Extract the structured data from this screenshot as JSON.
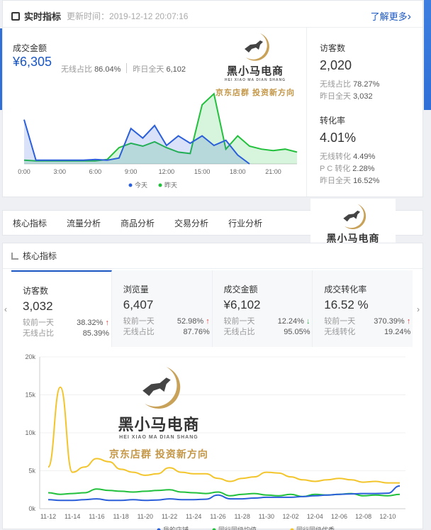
{
  "realtime": {
    "title": "实时指标",
    "update_label": "更新时间：",
    "update_time": "2019-12-12 20:07:16",
    "more_link": "了解更多",
    "more_arrow": "›",
    "gmv": {
      "label": "成交金额",
      "value": "¥6,305",
      "wireless_label": "无线占比",
      "wireless_value": "86.04%",
      "yesterday_label": "昨日全天",
      "yesterday_value": "6,102"
    },
    "visitors": {
      "label": "访客数",
      "value": "2,020",
      "wireless_label": "无线占比",
      "wireless_value": "78.27%",
      "yesterday_label": "昨日全天",
      "yesterday_value": "3,032"
    },
    "conversion": {
      "label": "转化率",
      "value": "4.01%",
      "wireless_label": "无线转化",
      "wireless_value": "4.49%",
      "pc_label": "P C 转化",
      "pc_value": "2.28%",
      "yesterday_label": "昨日全天",
      "yesterday_value": "16.52%"
    }
  },
  "watermark": {
    "main": "黑小马电商",
    "en": "HEI XIAO MA DIAN SHANG",
    "sub": "京东店群  投资新方向"
  },
  "tabs": [
    "核心指标",
    "流量分析",
    "商品分析",
    "交易分析",
    "行业分析"
  ],
  "core": {
    "title": "核心指标",
    "nav_left": "‹",
    "nav_right": "›",
    "cards": [
      {
        "label": "访客数",
        "value": "3,032",
        "cmp_label": "较前一天",
        "cmp_value": "38.32%",
        "trend": "↑",
        "wl_label": "无线占比",
        "wl_value": "85.39%"
      },
      {
        "label": "浏览量",
        "value": "6,407",
        "cmp_label": "较前一天",
        "cmp_value": "52.98%",
        "trend": "↑",
        "wl_label": "无线占比",
        "wl_value": "87.76%"
      },
      {
        "label": "成交金额",
        "value": "¥6,102",
        "cmp_label": "较前一天",
        "cmp_value": "12.24%",
        "trend": "↓",
        "wl_label": "无线占比",
        "wl_value": "95.05%"
      },
      {
        "label": "成交转化率",
        "value": "16.52 %",
        "cmp_label": "较前一天",
        "cmp_value": "370.39%",
        "trend": "↑",
        "wl_label": "无线转化",
        "wl_value": "19.24%"
      }
    ]
  },
  "colors": {
    "today": "#2b5fd9",
    "yesterday": "#22c03c",
    "peer_avg": "#22c03c",
    "peer_top": "#f3c52c",
    "accent": "#1a56c2"
  },
  "chart_data": [
    {
      "type": "area",
      "x": [
        "0:00",
        "1:00",
        "2:00",
        "3:00",
        "4:00",
        "5:00",
        "6:00",
        "7:00",
        "8:00",
        "9:00",
        "10:00",
        "11:00",
        "12:00",
        "13:00",
        "14:00",
        "15:00",
        "16:00",
        "17:00",
        "18:00",
        "19:00",
        "20:00",
        "21:00",
        "22:00",
        "23:00"
      ],
      "xticks": [
        "0:00",
        "3:00",
        "6:00",
        "9:00",
        "12:00",
        "15:00",
        "18:00",
        "21:00"
      ],
      "series": [
        {
          "name": "今天",
          "values": [
            60,
            5,
            5,
            5,
            5,
            5,
            6,
            5,
            8,
            48,
            35,
            52,
            25,
            38,
            28,
            38,
            25,
            32,
            12,
            0,
            null,
            null,
            null,
            null
          ]
        },
        {
          "name": "昨天",
          "values": [
            5,
            4,
            4,
            4,
            4,
            4,
            4,
            6,
            22,
            28,
            24,
            30,
            22,
            16,
            14,
            80,
            95,
            20,
            38,
            24,
            20,
            18,
            20,
            16
          ]
        }
      ]
    },
    {
      "type": "line",
      "x": [
        "11-12",
        "11-13",
        "11-14",
        "11-15",
        "11-16",
        "11-17",
        "11-18",
        "11-19",
        "11-20",
        "11-21",
        "11-22",
        "11-23",
        "11-24",
        "11-25",
        "11-26",
        "11-27",
        "11-28",
        "11-29",
        "11-30",
        "12-01",
        "12-02",
        "12-03",
        "12-04",
        "12-05",
        "12-06",
        "12-07",
        "12-08",
        "12-09",
        "12-10",
        "12-11"
      ],
      "xticks": [
        "11-12",
        "11-14",
        "11-16",
        "11-18",
        "11-20",
        "11-22",
        "11-24",
        "11-26",
        "11-28",
        "11-30",
        "12-02",
        "12-04",
        "12-06",
        "12-08",
        "12-10"
      ],
      "yticks": [
        "0k",
        "5k",
        "10k",
        "15k",
        "20k"
      ],
      "ylim": [
        0,
        20000
      ],
      "series": [
        {
          "name": "我的店铺",
          "values": [
            1200,
            1100,
            1100,
            1200,
            1300,
            1100,
            1100,
            1200,
            1100,
            1150,
            1300,
            1200,
            1200,
            1250,
            1800,
            1300,
            1300,
            1400,
            1500,
            1500,
            1500,
            1600,
            1700,
            1800,
            1900,
            1950,
            2000,
            2000,
            2050,
            3000
          ]
        },
        {
          "name": "同行同级均值",
          "values": [
            2100,
            1900,
            2000,
            2100,
            2600,
            2400,
            2300,
            2200,
            2300,
            2400,
            2500,
            2200,
            2100,
            2000,
            2200,
            1700,
            1900,
            2000,
            1800,
            1700,
            1900,
            1600,
            1900,
            1800,
            1900,
            2000,
            1700,
            1800,
            1700,
            1900
          ]
        },
        {
          "name": "同行同级优秀",
          "values": [
            5500,
            16000,
            4800,
            5500,
            6600,
            6200,
            5200,
            4800,
            4400,
            4600,
            5400,
            4800,
            4600,
            4600,
            4000,
            3600,
            4000,
            4200,
            4800,
            4700,
            4200,
            3800,
            3600,
            3800,
            4000,
            3800,
            3500,
            3600,
            3400,
            3400
          ]
        }
      ]
    }
  ]
}
